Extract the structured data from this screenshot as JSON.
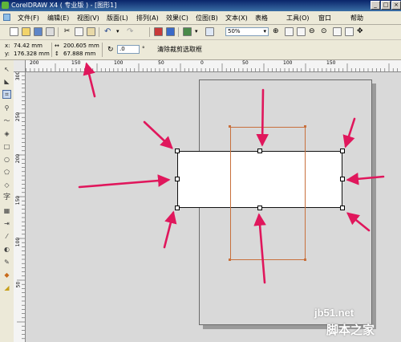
{
  "window": {
    "title": "CorelDRAW X4 ( 专业版 ) - [图形1]"
  },
  "menubar": {
    "items": [
      "文件(F)",
      "编辑(E)",
      "视图(V)",
      "版面(L)",
      "排列(A)",
      "效果(C)",
      "位图(B)",
      "文本(X)",
      "表格",
      "工具(O)",
      "窗口",
      "帮助"
    ]
  },
  "toolbar": {
    "zoom": "50%"
  },
  "propertybar": {
    "x_label": "x:",
    "x_value": "74.42 mm",
    "y_label": "y:",
    "y_value": "176.328 mm",
    "width_value": "200.605 mm",
    "height_value": "67.888 mm",
    "rotation": ".0",
    "rotation_unit": "°",
    "clear_button": "清除裁剪选取框"
  },
  "rulers": {
    "horizontal_labels": [
      "200",
      "150",
      "100",
      "50",
      "0",
      "50",
      "100",
      "150"
    ],
    "vertical_labels": [
      "300",
      "250",
      "200",
      "150",
      "100",
      "50"
    ]
  },
  "watermark": {
    "site": "jb51.net",
    "name": "脚本之家"
  },
  "colors": {
    "arrow": "#e0175c",
    "crop_frame": "#c8703c",
    "titlebar": "#0a246a"
  }
}
